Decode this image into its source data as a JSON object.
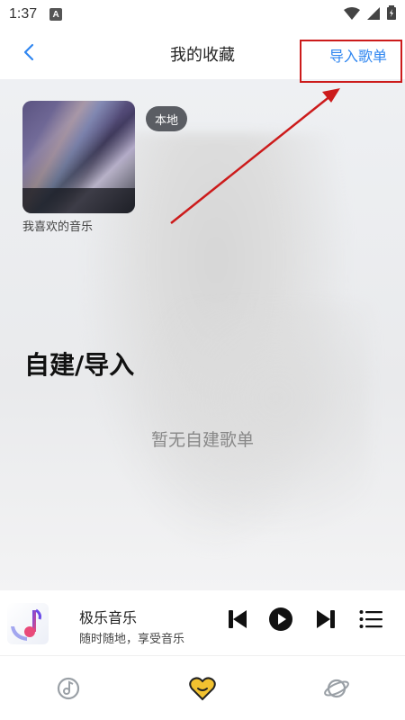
{
  "status": {
    "time": "1:37",
    "notif_letter": "A"
  },
  "header": {
    "title": "我的收藏",
    "import_label": "导入歌单"
  },
  "favorites": {
    "caption": "我喜欢的音乐",
    "badge": "本地"
  },
  "section": {
    "title": "自建/导入",
    "empty_text": "暂无自建歌单"
  },
  "player": {
    "title": "极乐音乐",
    "subtitle": "随时随地，享受音乐"
  },
  "colors": {
    "accent": "#2f86f0",
    "annotation": "#cc1b1b",
    "heart": "#f2c230"
  },
  "icons": {
    "back": "chevron-left-icon",
    "prev": "skip-previous-icon",
    "play": "play-icon",
    "next": "skip-next-icon",
    "playlist": "playlist-icon",
    "music_tab": "music-disc-icon",
    "favorites_tab": "heart-icon",
    "discover_tab": "planet-icon"
  }
}
